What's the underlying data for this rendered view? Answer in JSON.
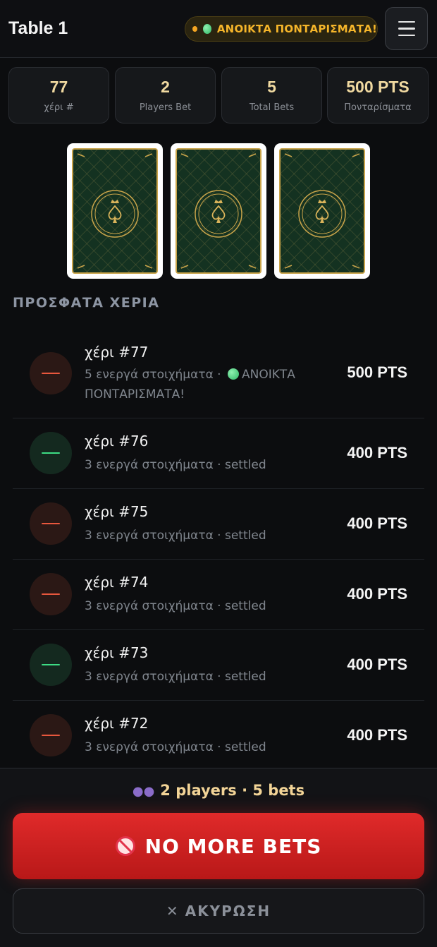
{
  "header": {
    "title": "Table 1",
    "status_label": "ΑΝΟΙΚΤΑ ΠΟΝΤΑΡΙΣΜΑΤΑ!",
    "menu_icon": "hamburger-menu-icon"
  },
  "stats": [
    {
      "value": "77",
      "label": "χέρι #"
    },
    {
      "value": "2",
      "label": "Players Bet"
    },
    {
      "value": "5",
      "label": "Total Bets"
    },
    {
      "value": "500 PTS",
      "label": "Πονταρίσματα"
    }
  ],
  "cards": {
    "count": 3,
    "face": "back",
    "back_color": "#143221",
    "emblem_icon": "spade-crown-icon"
  },
  "recent": {
    "title": "ΠΡΟΣΦΑΤΑ ΧΕΡΙΑ",
    "hands": [
      {
        "title": "χέρι #77",
        "sub_prefix": "5 ενεργά στοιχήματα · ",
        "sub_status": "ΑΝΟΙΚΤΑ ΠΟΝΤΑΡΙΣΜΑΤΑ!",
        "amount": "500 PTS",
        "tone": "red"
      },
      {
        "title": "χέρι #76",
        "sub": "3 ενεργά στοιχήματα · settled",
        "amount": "400 PTS",
        "tone": "green"
      },
      {
        "title": "χέρι #75",
        "sub": "3 ενεργά στοιχήματα · settled",
        "amount": "400 PTS",
        "tone": "red"
      },
      {
        "title": "χέρι #74",
        "sub": "3 ενεργά στοιχήματα · settled",
        "amount": "400 PTS",
        "tone": "red"
      },
      {
        "title": "χέρι #73",
        "sub": "3 ενεργά στοιχήματα · settled",
        "amount": "400 PTS",
        "tone": "green"
      },
      {
        "title": "χέρι #72",
        "sub": "3 ενεργά στοιχήματα · settled",
        "amount": "400 PTS",
        "tone": "red"
      }
    ]
  },
  "footer": {
    "summary": "2 players · 5 bets",
    "summary_icon": "players-icon",
    "no_more_bets_label": "NO MORE BETS",
    "no_more_bets_icon": "prohibited-icon",
    "cancel_label": "ΑΚΥΡΩΣΗ",
    "cancel_icon": "close-icon"
  },
  "colors": {
    "accent_gold": "#f0d9a0",
    "status_amber": "#f5b52a",
    "danger_red": "#e02a2a",
    "positive_green": "#3ddc84"
  }
}
